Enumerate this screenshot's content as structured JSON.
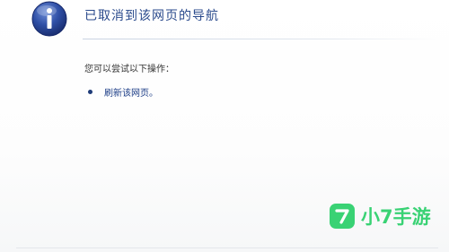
{
  "page": {
    "title": "已取消到该网页的导航",
    "prompt": "您可以尝试以下操作：",
    "actions": [
      {
        "label": "刷新该网页。"
      }
    ]
  },
  "icons": {
    "main": "info-icon",
    "bullet": "bullet-icon",
    "watermark_logo": "watermark-logo-icon"
  },
  "watermark": {
    "text": "小7手游",
    "color": "#39d274"
  },
  "colors": {
    "title": "#2a4a8c",
    "link": "#1c3d87",
    "icon_blue": "#233f8f"
  }
}
